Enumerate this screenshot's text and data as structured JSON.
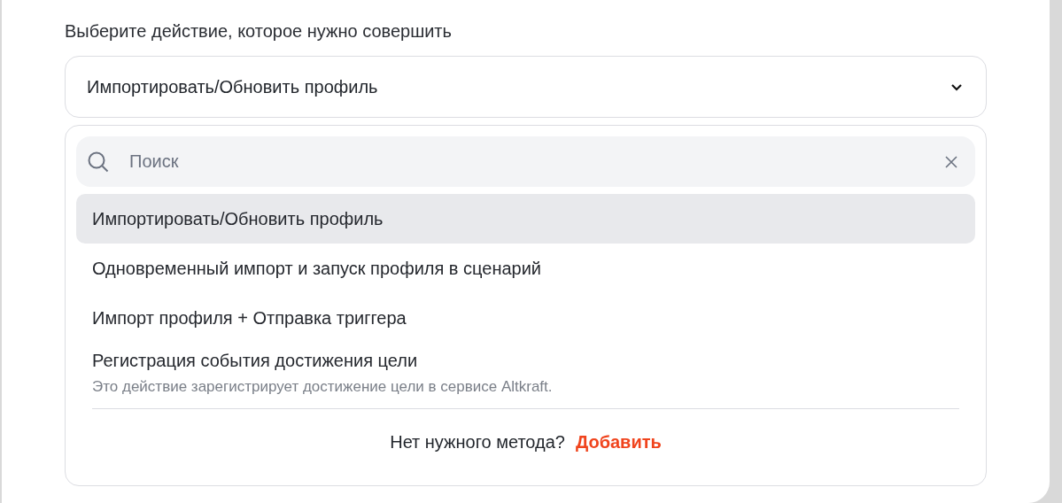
{
  "prompt": "Выберите действие, которое нужно совершить",
  "select": {
    "value": "Импортировать/Обновить профиль",
    "expanded": true
  },
  "search": {
    "placeholder": "Поиск"
  },
  "options": [
    {
      "label": "Импортировать/Обновить профиль",
      "selected": true
    },
    {
      "label": "Одновременный импорт и запуск профиля в сценарий",
      "selected": false
    },
    {
      "label": "Импорт профиля + Отправка триггера",
      "selected": false
    },
    {
      "label": "Регистрация события достижения цели",
      "description": "Это действие зарегистрирует достижение цели в сервисе Altkraft.",
      "selected": false
    }
  ],
  "footer": {
    "text": "Нет нужного метода?",
    "link": "Добавить"
  }
}
